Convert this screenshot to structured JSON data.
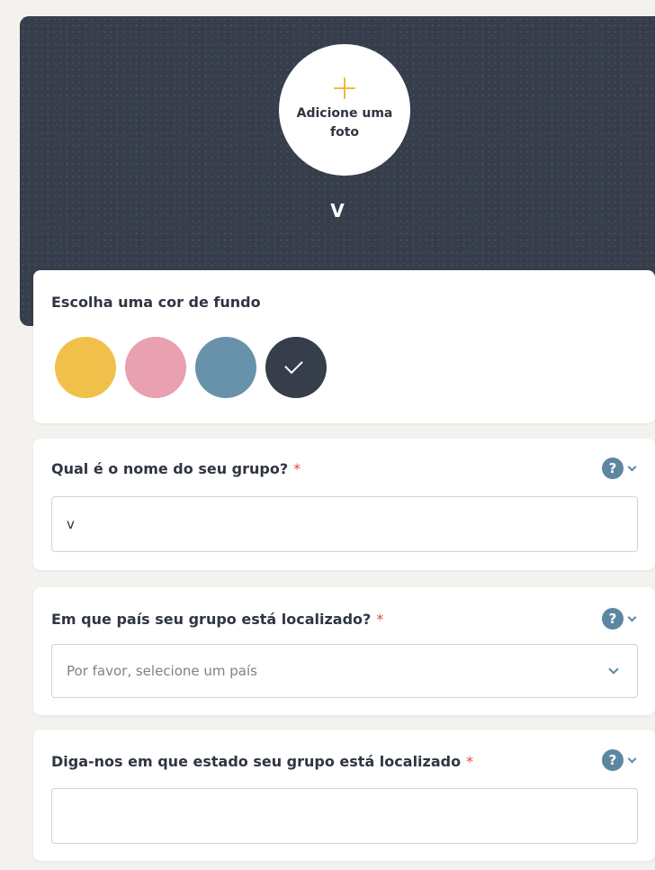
{
  "cover": {
    "add_photo_label": "Adicione uma foto",
    "group_initial": "V"
  },
  "background_color": {
    "title": "Escolha uma cor de fundo",
    "swatches": [
      {
        "name": "yellow",
        "color": "#f0c04a",
        "selected": false
      },
      {
        "name": "pink",
        "color": "#e9a0b0",
        "selected": false
      },
      {
        "name": "blue",
        "color": "#6892ab",
        "selected": false
      },
      {
        "name": "dark",
        "color": "#363d4b",
        "selected": true
      }
    ]
  },
  "group_name": {
    "label": "Qual é o nome do seu grupo?",
    "required_mark": "*",
    "value": "v"
  },
  "country": {
    "label": "Em que país seu grupo está localizado?",
    "required_mark": "*",
    "placeholder": "Por favor, selecione um país"
  },
  "state": {
    "label": "Diga-nos em que estado seu grupo está localizado",
    "required_mark": "*",
    "value": ""
  },
  "icons": {
    "help": "?",
    "accent": "#5d87a1",
    "plus_color": "#f0b93c",
    "required_color": "#e0474c"
  }
}
